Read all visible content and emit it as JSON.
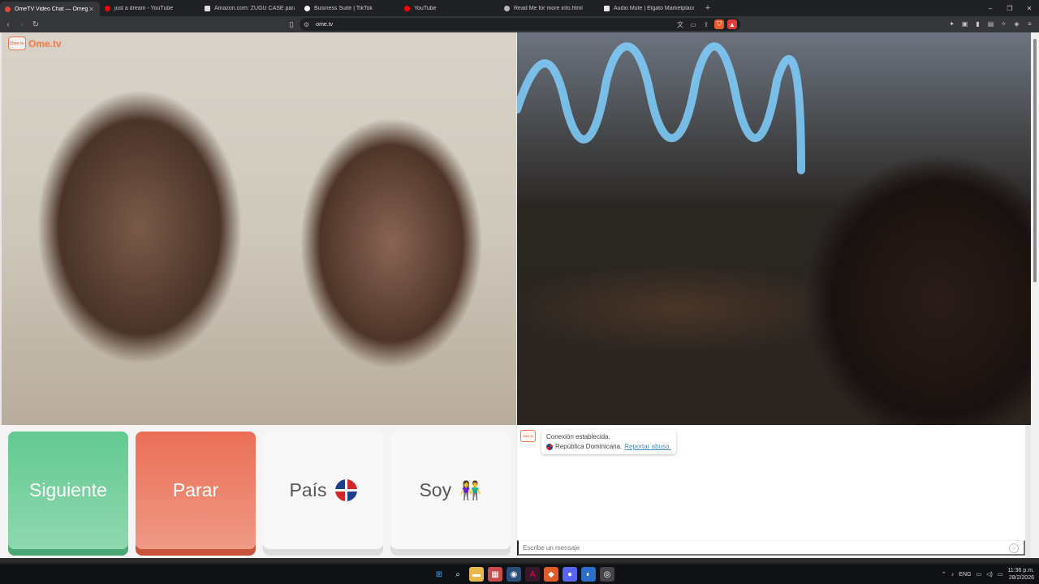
{
  "browser": {
    "tabs": [
      {
        "title": "OmeTV Video Chat — Omegle",
        "active": true,
        "icon": "ometv-favicon",
        "icon_color": "#e04a3a"
      },
      {
        "title": "just a dream - YouTube",
        "active": false,
        "icon": "youtube-favicon",
        "icon_color": "#ff0000"
      },
      {
        "title": "Amazon.com: ZUGU CASE para iPad",
        "active": false,
        "icon": "amazon-favicon",
        "icon_color": "#dddddd"
      },
      {
        "title": "Business Suite | TikTok",
        "active": false,
        "icon": "tiktok-favicon",
        "icon_color": "#ffffff"
      },
      {
        "title": "YouTube",
        "active": false,
        "icon": "youtube-favicon",
        "icon_color": "#ff0000"
      },
      {
        "title": "Read Me for more info.html",
        "active": false,
        "icon": "globe-favicon",
        "icon_color": "#bbbbbb"
      },
      {
        "title": "Audio Mute | Elgato Marketplace",
        "active": false,
        "icon": "elgato-favicon",
        "icon_color": "#e8e8e8"
      }
    ],
    "new_tab_glyph": "+",
    "address": {
      "url": "ome.tv"
    },
    "shield_count": "5",
    "window_controls": [
      "–",
      "❐",
      "✕"
    ]
  },
  "site": {
    "logo_text": "Ome.tv",
    "logo_badge": "Ome tv"
  },
  "controls": {
    "next_label": "Siguiente",
    "stop_label": "Parar",
    "country_label": "País",
    "gender_label": "Soy",
    "gender_emoji": "👫"
  },
  "chat": {
    "avatar_text": "Ome tv",
    "status": "Conexión establecida.",
    "country": "República Dominicana.",
    "report_link": "Reportar abuso.",
    "input_placeholder": "Escribe un mensaje"
  },
  "taskbar": {
    "language": "ENG",
    "time": "11:36 p.m.",
    "date": "28/2/2026"
  },
  "colors": {
    "brand": "#f07a45",
    "next_green": "#62c991",
    "stop_red": "#ea6e55",
    "neon_blue": "#7fd0ff",
    "link": "#4a8fb8"
  }
}
